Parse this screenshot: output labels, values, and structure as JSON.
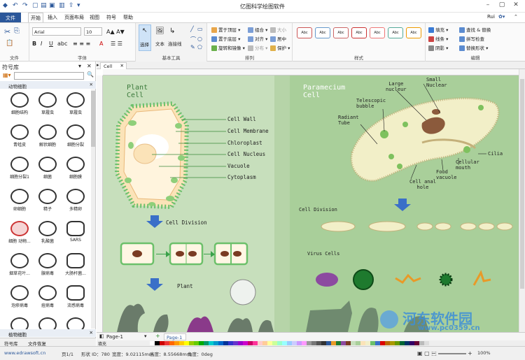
{
  "app": {
    "title": "亿图科学绘图软件",
    "user": "Rui"
  },
  "menu": {
    "file": "文件",
    "tabs": [
      "开始",
      "插入",
      "页面布局",
      "视图",
      "符号",
      "帮助"
    ]
  },
  "ribbon": {
    "font_name": "Arial",
    "font_size": "10",
    "select_label": "选择",
    "text_label": "文本",
    "connector_label": "连接线",
    "arrange": {
      "bring_front": "置于顶层",
      "send_back": "置于底层",
      "rotate": "旋转和镜像",
      "group": "组合",
      "align": "对齐",
      "distribute": "分布",
      "size": "大小",
      "center": "居中",
      "protect": "保护"
    },
    "style_sample": "Abc",
    "edit": {
      "fill": "填充",
      "line": "线条",
      "shadow": "阴影",
      "find_replace": "查找 & 替换",
      "format_painter": "拼写检查",
      "replace_shape": "替换形状"
    },
    "groups": [
      "文件",
      "字体",
      "基本工具",
      "排列",
      "样式",
      "编辑"
    ]
  },
  "library": {
    "title": "符号库",
    "category": "动物细胞",
    "category2": "植物细胞",
    "symbols": [
      "细胞结构",
      "草履虫",
      "草履虫",
      "青蛙皮",
      "解状细胞",
      "细胞分裂",
      "细胞分裂1",
      "细菌",
      "细胞膜",
      "卵细胞",
      "精子",
      "多精卵",
      "细胞 动物...",
      "乳酸菌",
      "SARS",
      "烟草花叶...",
      "腺病毒",
      "大肠杆菌...",
      "泡疹病毒",
      "痘病毒",
      "流感病毒",
      "",
      "",
      ""
    ],
    "tabs": [
      "符号库",
      "文件恢复"
    ]
  },
  "document": {
    "tab": "Cell",
    "page": "Page-1",
    "page_tab": "Page-1"
  },
  "canvas": {
    "plant_title": "Plant\nCell",
    "plant_labels": [
      "Cell Wall",
      "Cell Membrane",
      "Chloroplast",
      "Cell Nucleus",
      "Vacuole",
      "Cytoplasm"
    ],
    "cell_division": "Cell Division",
    "plant": "Plant",
    "paramecium_title": "Paramecium\nCell",
    "para_labels": {
      "large_nucleus": "Large\nnucleur",
      "small_nuclear": "Small\nNuclear",
      "telescopic": "Telescopic\nbubble",
      "radiant": "Radiant\nTube",
      "cilia": "Cilia",
      "cellular_mouth": "Cellular\nmouth",
      "food_vacuole": "Food\nvacuole",
      "anal_hole": "Cell anal\nhole"
    },
    "cell_division2": "Cell Division",
    "virus_cells": "Virus Cells"
  },
  "fill_label": "填充",
  "status": {
    "url": "www.edrawsoft.cn",
    "page": "页1/1",
    "shape_id": "形状 ID：780",
    "width": "宽度：9.02115mm",
    "height": "高度：8.55668mm",
    "angle": "角度：0deg",
    "zoom": "100%"
  },
  "watermark": {
    "brand": "河东软件园",
    "url": "www.pc0359.cn"
  },
  "colors": {
    "accent": "#2b579a",
    "canvas_green": "#c7dfbc",
    "plant_cell": "#fbe3b8",
    "chloroplast": "#8fcf7a"
  }
}
